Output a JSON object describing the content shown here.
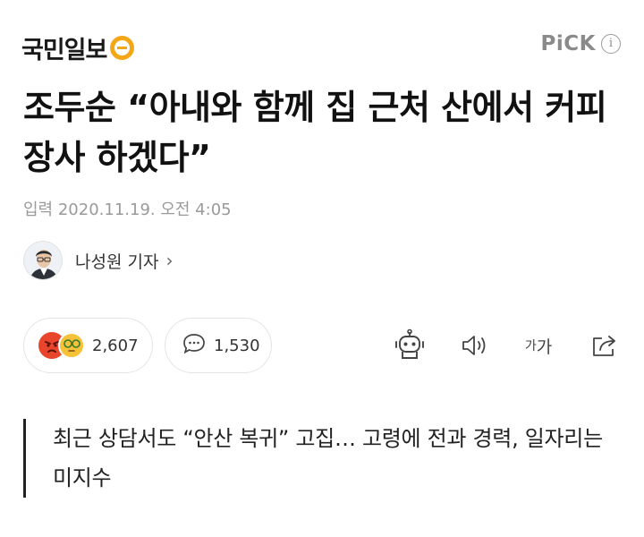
{
  "header": {
    "logo_text": "국민일보",
    "pick_label": "PiCK",
    "info_glyph": "i"
  },
  "article": {
    "headline": "조두순 “아내와 함께 집 근처 산에서 커피장사 하겠다”",
    "dateline": "입력 2020.11.19. 오전 4:05",
    "reporter": "나성원 기자",
    "reporter_chevron": "›",
    "subtitle": "최근 상담서도 “안산 복귀” 고집… 고령에 전과 경력, 일자리는 미지수"
  },
  "toolbar": {
    "reaction_count": "2,607",
    "comment_count": "1,530",
    "font_small": "가",
    "font_large": "가"
  },
  "colors": {
    "logo_accent": "#f4a716",
    "angry_emoji": "#e8452c",
    "glasses_emoji": "#f6c23a"
  }
}
